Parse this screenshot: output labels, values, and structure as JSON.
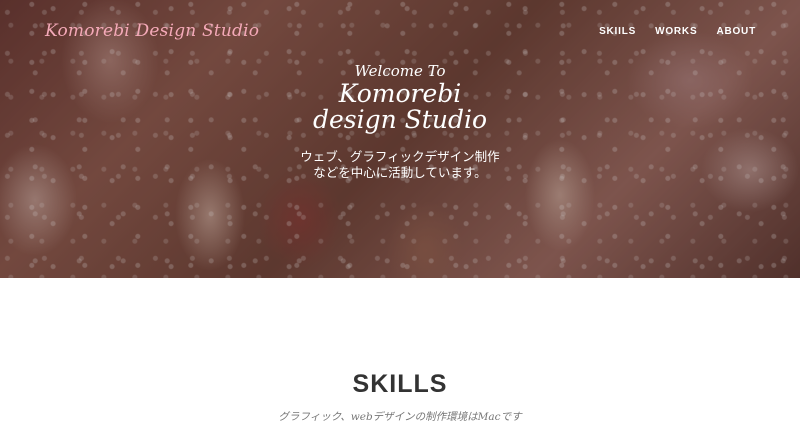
{
  "header": {
    "brand": "Komorebi Design Studio",
    "nav": [
      {
        "label": "SKIILS"
      },
      {
        "label": "WORKS"
      },
      {
        "label": "ABOUT"
      }
    ]
  },
  "hero": {
    "welcome": "Welcome To",
    "title_line1": "Komorebi",
    "title_line2": "design Studio",
    "subtitle_line1": "ウェブ、グラフィックデザイン制作",
    "subtitle_line2": "などを中心に活動しています。"
  },
  "skills": {
    "title": "SKILLS",
    "description": "グラフィック、webデザインの制作環境はMacです"
  },
  "colors": {
    "brand": "#f4a9b8",
    "nav_text": "#ffffff",
    "heading": "#333333",
    "body_text": "#777777"
  }
}
